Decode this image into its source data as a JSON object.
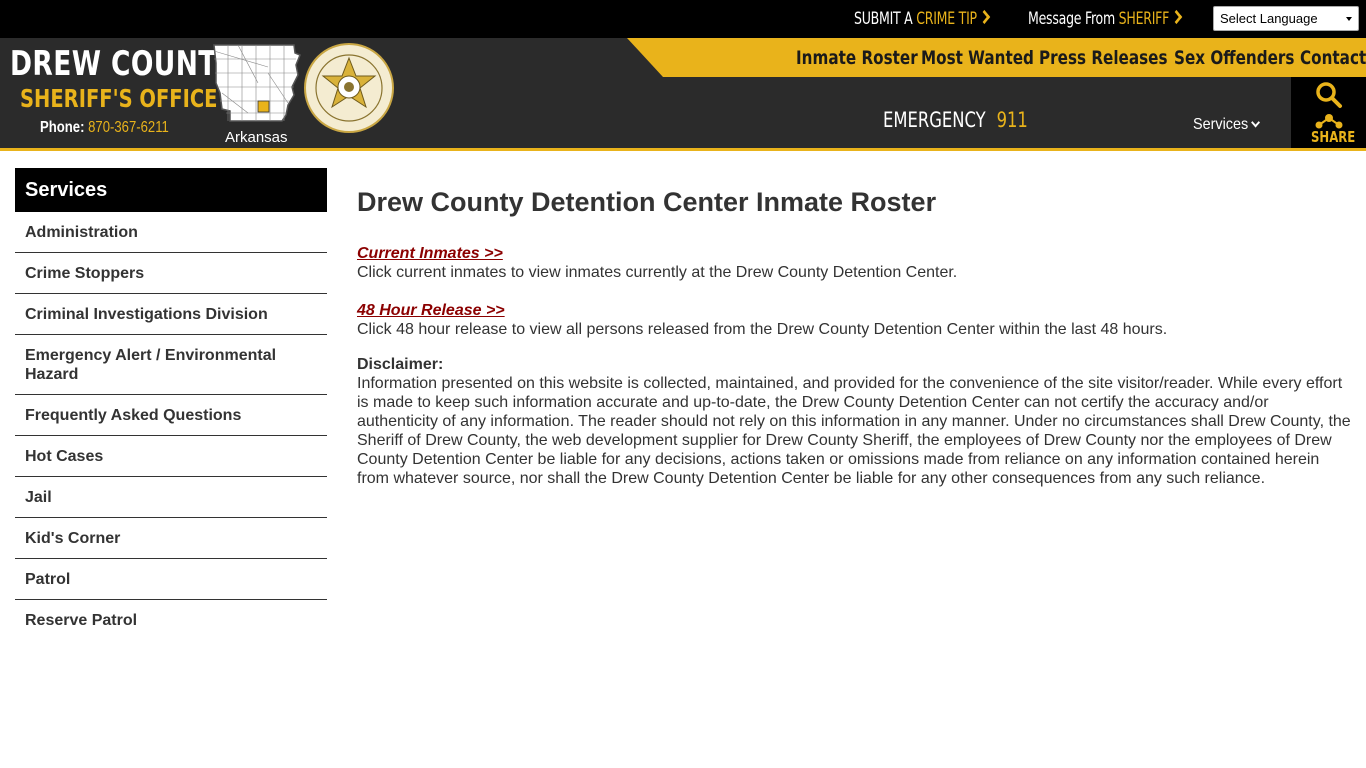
{
  "topbar": {
    "submit_prefix": "SUBMIT A ",
    "submit_accent": "CRIME TIP",
    "message_prefix": "Message From ",
    "message_accent": "SHERIFF",
    "language_select": "Select Language"
  },
  "brand": {
    "line1": "DREW COUNTY",
    "line2": "SHERIFF'S OFFICE",
    "phone_label": "Phone: ",
    "phone_number": "870-367-6211",
    "state": "Arkansas"
  },
  "nav": {
    "items": [
      "Inmate Roster",
      "Most Wanted",
      "Press Releases",
      "Sex Offenders",
      "Contact"
    ],
    "emergency_label": "EMERGENCY",
    "emergency_number": "911",
    "services_label": "Services",
    "share_label": "SHARE"
  },
  "sidebar": {
    "title": "Services",
    "items": [
      "Administration",
      "Crime Stoppers",
      "Criminal Investigations Division",
      "Emergency Alert / Environmental Hazard",
      "Frequently Asked Questions",
      "Hot Cases",
      "Jail",
      "Kid's Corner",
      "Patrol",
      "Reserve Patrol"
    ]
  },
  "main": {
    "title": "Drew County Detention Center Inmate Roster",
    "current_link": "Current Inmates >>",
    "current_text": "Click current inmates to view inmates currently at the Drew County Detention Center.",
    "release_link": "48 Hour Release >>",
    "release_text": "Click 48 hour release to view all persons released from the Drew County Detention Center within the last 48 hours.",
    "disclaimer_label": "Disclaimer:",
    "disclaimer_text": "Information presented on this website is collected, maintained, and provided for the convenience of the site visitor/reader. While every effort is made to keep such information accurate and up-to-date, the Drew County Detention Center can not certify the accuracy and/or authenticity of any information. The reader should not rely on this information in any manner.  Under no circumstances shall Drew County, the Sheriff of Drew County, the web development supplier for Drew County Sheriff, the employees of Drew County nor the employees of Drew County Detention Center be liable for any decisions, actions taken or omissions made from reliance on any information contained herein from whatever source, nor shall the Drew County Detention Center be liable for any other consequences from any such reliance."
  },
  "colors": {
    "accent": "#e9b31b",
    "header_bg": "#2b2b2b",
    "link": "#8b0000"
  }
}
